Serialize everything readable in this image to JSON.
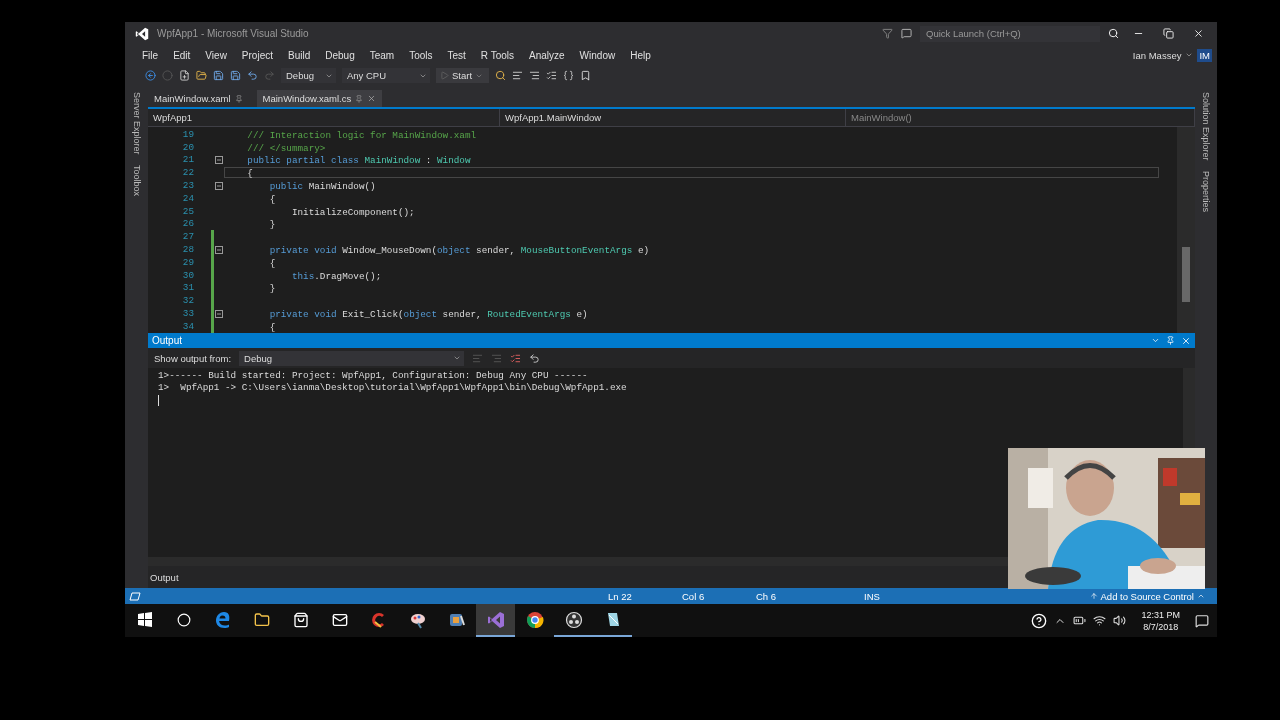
{
  "window": {
    "title": "WpfApp1 - Microsoft Visual Studio"
  },
  "quick_launch": {
    "placeholder": "Quick Launch (Ctrl+Q)"
  },
  "account": {
    "name": "Ian Massey",
    "initials": "IM"
  },
  "menu": [
    "File",
    "Edit",
    "View",
    "Project",
    "Build",
    "Debug",
    "Team",
    "Tools",
    "Test",
    "R Tools",
    "Analyze",
    "Window",
    "Help"
  ],
  "toolbar": {
    "configuration": "Debug",
    "platform": "Any CPU",
    "start": "Start"
  },
  "side_tabs_left": [
    "Server Explorer",
    "Toolbox"
  ],
  "side_tabs_right": [
    "Solution Explorer",
    "Properties"
  ],
  "doc_tabs": [
    {
      "label": "MainWindow.xaml",
      "selected": false
    },
    {
      "label": "MainWindow.xaml.cs",
      "selected": true
    }
  ],
  "nav_bar": {
    "project": "WpfApp1",
    "type": "WpfApp1.MainWindow",
    "member": "MainWindow()"
  },
  "code": [
    {
      "number": "19",
      "fold": false,
      "changed": false,
      "current": false,
      "tokens": [
        {
          "kind": "comment",
          "text": "    /// Interaction logic for MainWindow.xaml"
        }
      ]
    },
    {
      "number": "20",
      "fold": false,
      "changed": false,
      "current": false,
      "tokens": [
        {
          "kind": "comment",
          "text": "    /// </summary>"
        }
      ]
    },
    {
      "number": "21",
      "fold": true,
      "changed": false,
      "current": false,
      "tokens": [
        {
          "kind": "keyword",
          "text": "    public partial class "
        },
        {
          "kind": "type",
          "text": "MainWindow"
        },
        {
          "kind": "plain",
          "text": " : "
        },
        {
          "kind": "type",
          "text": "Window"
        }
      ]
    },
    {
      "number": "22",
      "fold": false,
      "changed": false,
      "current": true,
      "tokens": [
        {
          "kind": "plain",
          "text": "    {"
        }
      ]
    },
    {
      "number": "23",
      "fold": true,
      "changed": false,
      "current": false,
      "tokens": [
        {
          "kind": "keyword",
          "text": "        public "
        },
        {
          "kind": "plain",
          "text": "MainWindow()"
        }
      ]
    },
    {
      "number": "24",
      "fold": false,
      "changed": false,
      "current": false,
      "tokens": [
        {
          "kind": "plain",
          "text": "        {"
        }
      ]
    },
    {
      "number": "25",
      "fold": false,
      "changed": false,
      "current": false,
      "tokens": [
        {
          "kind": "plain",
          "text": "            InitializeComponent();"
        }
      ]
    },
    {
      "number": "26",
      "fold": false,
      "changed": false,
      "current": false,
      "tokens": [
        {
          "kind": "plain",
          "text": "        }"
        }
      ]
    },
    {
      "number": "27",
      "fold": false,
      "changed": true,
      "current": false
    },
    {
      "number": "28",
      "fold": true,
      "changed": true,
      "current": false,
      "tokens": [
        {
          "kind": "keyword",
          "text": "        private void "
        },
        {
          "kind": "plain",
          "text": "Window_MouseDown("
        },
        {
          "kind": "keyword",
          "text": "object"
        },
        {
          "kind": "plain",
          "text": " sender, "
        },
        {
          "kind": "type",
          "text": "MouseButtonEventArgs"
        },
        {
          "kind": "plain",
          "text": " e)"
        }
      ]
    },
    {
      "number": "29",
      "fold": false,
      "changed": true,
      "current": false,
      "tokens": [
        {
          "kind": "plain",
          "text": "        {"
        }
      ]
    },
    {
      "number": "30",
      "fold": false,
      "changed": true,
      "current": false,
      "tokens": [
        {
          "kind": "keyword",
          "text": "            this"
        },
        {
          "kind": "plain",
          "text": ".DragMove();"
        }
      ]
    },
    {
      "number": "31",
      "fold": false,
      "changed": true,
      "current": false,
      "tokens": [
        {
          "kind": "plain",
          "text": "        }"
        }
      ]
    },
    {
      "number": "32",
      "fold": false,
      "changed": true,
      "current": false
    },
    {
      "number": "33",
      "fold": true,
      "changed": true,
      "current": false,
      "tokens": [
        {
          "kind": "keyword",
          "text": "        private void "
        },
        {
          "kind": "plain",
          "text": "Exit_Click("
        },
        {
          "kind": "keyword",
          "text": "object"
        },
        {
          "kind": "plain",
          "text": " sender, "
        },
        {
          "kind": "type",
          "text": "RoutedEventArgs"
        },
        {
          "kind": "plain",
          "text": " e)"
        }
      ]
    },
    {
      "number": "34",
      "fold": false,
      "changed": true,
      "current": false,
      "tokens": [
        {
          "kind": "plain",
          "text": "        {"
        }
      ]
    }
  ],
  "output": {
    "title": "Output",
    "source_label": "Show output from:",
    "source": "Debug",
    "lines": [
      "1>------ Build started: Project: WpfApp1, Configuration: Debug Any CPU ------",
      "1>  WpfApp1 -> C:\\Users\\ianma\\Desktop\\tutorial\\WpfApp1\\WpfApp1\\bin\\Debug\\WpfApp1.exe"
    ],
    "tab": "Output"
  },
  "status_bar": {
    "items": [
      "Ln 22",
      "Col 6",
      "Ch 6",
      "INS"
    ],
    "source_control": "Add to Source Control"
  },
  "taskbar": {
    "apps": [
      {
        "kind": "start",
        "selected": false,
        "running": false
      },
      {
        "kind": "cortana",
        "selected": false,
        "running": false
      },
      {
        "kind": "edge",
        "selected": false,
        "running": false
      },
      {
        "kind": "explorer",
        "selected": false,
        "running": false
      },
      {
        "kind": "store",
        "selected": false,
        "running": false
      },
      {
        "kind": "mail",
        "selected": false,
        "running": false
      },
      {
        "kind": "cleaner",
        "selected": false,
        "running": false
      },
      {
        "kind": "paint",
        "selected": false,
        "running": false
      },
      {
        "kind": "media",
        "selected": false,
        "running": false
      },
      {
        "kind": "vs",
        "selected": true,
        "running": true
      },
      {
        "kind": "chrome",
        "selected": false,
        "running": false
      },
      {
        "kind": "obs",
        "selected": false,
        "running": true
      },
      {
        "kind": "notes",
        "selected": false,
        "running": true
      }
    ],
    "time": "12:31 PM",
    "date": "8/7/2018"
  }
}
